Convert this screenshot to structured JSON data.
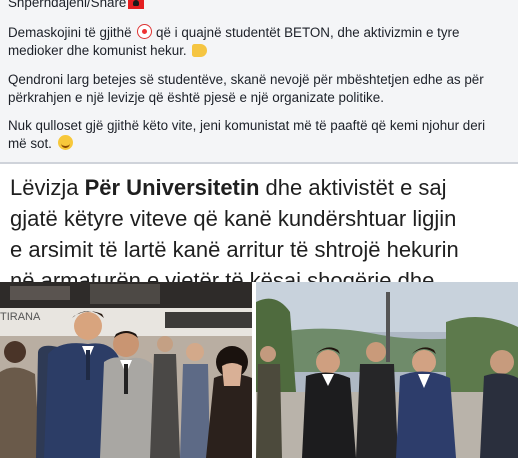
{
  "post": {
    "line1": "Shpërndajeni/Share",
    "line2_a": "Demaskojini të gjithë",
    "line2_b": "që i quajnë studentët BETON, dhe aktivizmin e tyre medioker dhe komunist hekur.",
    "line3": "Qendroni larg betejes së studentëve, skanë nevojë për mbështetjen edhe as për përkrahjen e një levizje që është pjesë e një organizate politike.",
    "line4": "Nuk qulloset gjë gjithë këto vite, jeni komunistat më të paaftë që kemi njohur deri më sot."
  },
  "emojis": {
    "flag": "albania-flag-icon",
    "clown": "clown-face-icon",
    "hand": "pointing-hand-icon",
    "smile": "grinning-face-icon"
  },
  "shared_image": {
    "text_a": "Lëvizja ",
    "text_bold": "Për Universitetin",
    "text_b": " dhe aktivistët e saj",
    "text_line2": "gjatë këtyre viteve që kanë kundërshtuar ligjin",
    "text_line3": "e arsimit të lartë kanë arritur të shtrojë hekurin",
    "text_line4": "në armaturën e vjetër të kësaj shoqërie dhe"
  },
  "photo_left": {
    "sign_text": "TIRANA"
  },
  "colors": {
    "text": "#1d2129",
    "post_bg": "#f4f5f7"
  }
}
